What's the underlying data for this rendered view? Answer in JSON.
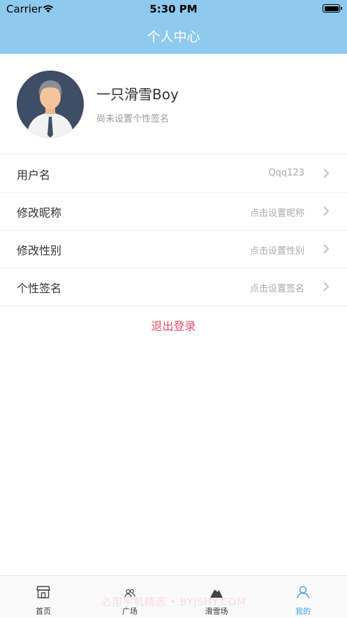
{
  "status_bar": {
    "carrier": "Carrier",
    "time": "5:30 PM"
  },
  "nav": {
    "title": "个人中心"
  },
  "profile": {
    "nickname": "一只滑雪Boy",
    "signature": "尚未设置个性签名"
  },
  "settings": [
    {
      "label": "用户名",
      "value": "Qqq123"
    },
    {
      "label": "修改昵称",
      "value": "点击设置昵称"
    },
    {
      "label": "修改性别",
      "value": "点击设置性别"
    },
    {
      "label": "个性签名",
      "value": "点击设置签名"
    }
  ],
  "logout_label": "退出登录",
  "tabs": [
    {
      "label": "首页",
      "icon": "storefront-icon"
    },
    {
      "label": "广场",
      "icon": "people-icon"
    },
    {
      "label": "滑雪场",
      "icon": "mountain-icon"
    },
    {
      "label": "我的",
      "icon": "person-icon",
      "active": true
    }
  ],
  "watermark": "必用手机精选 • BYJSHY.COM",
  "colors": {
    "header": "#8ec9ee",
    "active_tab": "#3fa0e5",
    "logout": "#e8506b"
  }
}
